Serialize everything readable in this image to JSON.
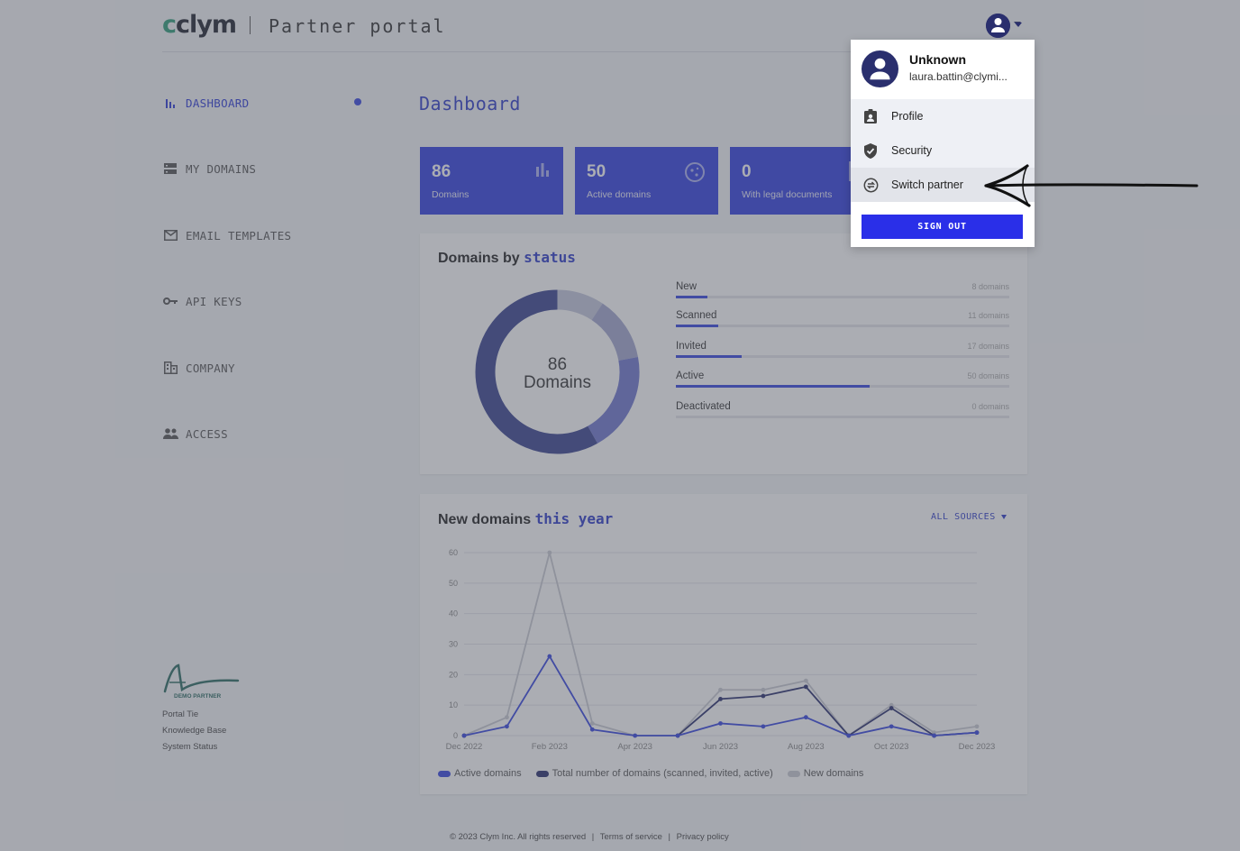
{
  "header": {
    "brand": "clym",
    "portal_title": "Partner portal"
  },
  "sidebar": {
    "items": [
      {
        "label": "DASHBOARD",
        "icon": "bar-chart-icon",
        "active": true
      },
      {
        "label": "MY DOMAINS",
        "icon": "storage-icon"
      },
      {
        "label": "EMAIL TEMPLATES",
        "icon": "mail-icon"
      },
      {
        "label": "API KEYS",
        "icon": "key-icon"
      },
      {
        "label": "COMPANY",
        "icon": "building-icon"
      },
      {
        "label": "ACCESS",
        "icon": "people-icon"
      }
    ],
    "partner_logo_text": "DEMO PARTNER",
    "footer_links": [
      "Portal Tie",
      "Knowledge Base",
      "System Status"
    ]
  },
  "main": {
    "title": "Dashboard",
    "stats": [
      {
        "value": "86",
        "label": "Domains",
        "icon": "bar-chart-icon"
      },
      {
        "value": "50",
        "label": "Active domains",
        "icon": "cookie-icon"
      },
      {
        "value": "0",
        "label": "With legal documents",
        "icon": "document-icon"
      }
    ],
    "status_panel": {
      "title_plain": "Domains by",
      "title_highlight": "status",
      "donut_value": "86",
      "donut_label": "Domains",
      "rows": [
        {
          "name": "New",
          "count": "8 domains",
          "fraction": 0.095
        },
        {
          "name": "Scanned",
          "count": "11 domains",
          "fraction": 0.128
        },
        {
          "name": "Invited",
          "count": "17 domains",
          "fraction": 0.198
        },
        {
          "name": "Active",
          "count": "50 domains",
          "fraction": 0.581
        },
        {
          "name": "Deactivated",
          "count": "0 domains",
          "fraction": 0
        }
      ]
    },
    "chart_panel": {
      "title_plain": "New domains",
      "title_highlight": "this year",
      "sources_label": "ALL SOURCES"
    }
  },
  "chart_data": {
    "type": "line",
    "x_labels": [
      "Dec 2022",
      "Jan 2023",
      "Feb 2023",
      "Mar 2023",
      "Apr 2023",
      "May 2023",
      "Jun 2023",
      "Jul 2023",
      "Aug 2023",
      "Sep 2023",
      "Oct 2023",
      "Nov 2023",
      "Dec 2023"
    ],
    "x_tick_labels": [
      "Dec 2022",
      "Feb 2023",
      "Apr 2023",
      "Jun 2023",
      "Aug 2023",
      "Oct 2023",
      "Dec 2023"
    ],
    "y_ticks": [
      0,
      10,
      20,
      30,
      40,
      50,
      60
    ],
    "ylim": [
      0,
      60
    ],
    "grid": true,
    "legend_position": "bottom-left",
    "series": [
      {
        "name": "Active domains",
        "color": "#3645e0",
        "values": [
          0,
          3,
          26,
          2,
          0,
          0,
          4,
          3,
          6,
          0,
          3,
          0,
          1
        ]
      },
      {
        "name": "Total number of domains (scanned, invited, active)",
        "color": "#2a2f6e",
        "values": [
          0,
          null,
          null,
          null,
          null,
          0,
          12,
          13,
          16,
          0,
          9,
          0,
          1
        ]
      },
      {
        "name": "New domains",
        "color": "#c9cbd3",
        "values": [
          0,
          6,
          60,
          4,
          0,
          0,
          15,
          15,
          18,
          0,
          10,
          1,
          3
        ]
      }
    ]
  },
  "footer": {
    "copyright": "© 2023 Clym Inc. All rights reserved",
    "links": [
      "Terms of service",
      "Privacy policy"
    ]
  },
  "user_menu": {
    "name": "Unknown",
    "email": "laura.battin@clymi...",
    "items": [
      {
        "label": "Profile",
        "icon": "badge-icon"
      },
      {
        "label": "Security",
        "icon": "shield-icon"
      },
      {
        "label": "Switch partner",
        "icon": "switch-icon"
      }
    ],
    "sign_out_label": "SIGN OUT"
  },
  "colors": {
    "accent": "#3645e0",
    "card_bg": "#3340e0",
    "dark": "#2a2f6e",
    "signout": "#2a2fe8"
  }
}
